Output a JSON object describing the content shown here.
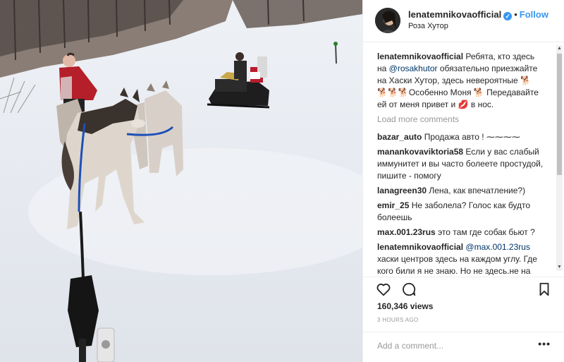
{
  "post": {
    "username": "lenatemnikovaofficial",
    "verified_icon": "verified-badge-icon",
    "separator": "•",
    "follow_label": "Follow",
    "location": "Роза Хутор",
    "caption_user": "lenatemnikovaofficial",
    "caption_part1": " Ребята, кто здесь на ",
    "caption_mention": "@rosakhutor",
    "caption_part2": " обязательно приезжайте на Хаски Хутор, здесь невероятные 🐕 🐕🐕🐕Особенно Моня 🐕 Передавайте ей от меня привет и 💋 в нос.",
    "load_more": "Load more comments",
    "views": "160,346 views",
    "time": "3 HOURS AGO",
    "add_comment_placeholder": "Add a comment...",
    "more_options": "•••"
  },
  "comments": [
    {
      "user": "bazar_auto",
      "text": " Продажа авто ! ⁓⁓⁓⁓"
    },
    {
      "user": "manankovaviktoria58",
      "text": " Если у вас слабый иммунитет и вы часто болеете простудой, пишите - помогу"
    },
    {
      "user": "lanagreen30",
      "text": " Лена, как впечатление?)"
    },
    {
      "user": "emir_25",
      "text": " Не заболела? Голос как будто болеешь"
    },
    {
      "user": "max.001.23rus",
      "text": " это там где собак бьют ?"
    },
    {
      "user": "lenatemnikovaofficial",
      "mention": "@max.001.23rus",
      "text": " хаски центров здесь на каждом углу. Где кого били я не знаю. Но не здесь.не на"
    }
  ],
  "colors": {
    "accent": "#3897f0",
    "mention": "#003569",
    "muted": "#999999",
    "text": "#262626"
  },
  "icons": [
    "heart-icon",
    "comment-icon",
    "bookmark-icon",
    "verified-badge-icon"
  ]
}
